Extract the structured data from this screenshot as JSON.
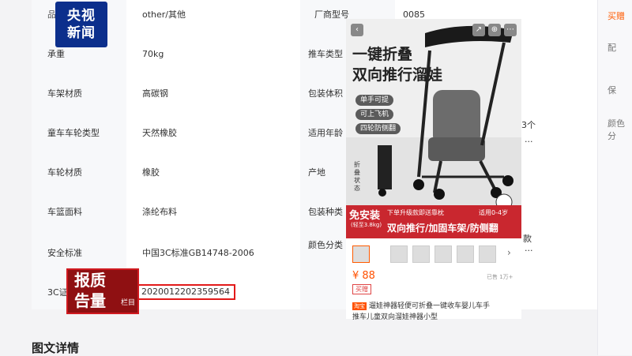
{
  "specs": {
    "left": [
      {
        "key": "品",
        "value": "other/其他"
      },
      {
        "key": "承重",
        "value": "70kg"
      },
      {
        "key": "车架材质",
        "value": "高碳钢"
      },
      {
        "key": "童车车轮类型",
        "value": "天然橡胶"
      },
      {
        "key": "车轮材质",
        "value": "橡胶"
      },
      {
        "key": "车篮面料",
        "value": "涤纶布料"
      },
      {
        "key": "安全标准",
        "value": "中国3C标准GB14748-2006"
      },
      {
        "key": "3C证",
        "value": "2020012202359564"
      }
    ],
    "right": [
      {
        "key": "厂商型号",
        "value": "0085"
      },
      {
        "key": "推车类型",
        "value": ""
      },
      {
        "key": "包装体积",
        "value": ""
      },
      {
        "key": "适用年龄",
        "value": "3个"
      },
      {
        "key": "产地",
        "value": ""
      },
      {
        "key": "包装种类",
        "value": ""
      },
      {
        "key": "颜色分类",
        "value": "款"
      }
    ]
  },
  "section_title": "图文详情",
  "right_rail": [
    "买赠",
    "配",
    "保",
    "颜色分"
  ],
  "watermark": {
    "line1": "央视",
    "line2": "新闻"
  },
  "program_logo": {
    "line1": "报质",
    "line2": "告量",
    "small": "栏目"
  },
  "product": {
    "promo_line1": "一键折叠",
    "promo_line2": "双向推行溜娃",
    "pills": [
      "单手可提",
      "可上飞机",
      "四轮防侧翻"
    ],
    "fold_label": "折叠状态",
    "banner": {
      "free_install": "免安装",
      "weight": "(轻至3.8kg)",
      "upgrade": "下单升级款即送靠枕",
      "age": "适用0-4岁",
      "features": "双向推行/加固车架/防侧翻"
    },
    "price": "¥ 88",
    "sold": "已售 1万+",
    "tag": "买赠",
    "title_badge": "淘宝",
    "title_line1": "遛娃神器轻便可折叠一键收车婴儿车手",
    "title_line2": "推车儿童双向溜娃神器小型"
  },
  "colors": {
    "accent": "#ff5000",
    "badge_blue": "#0c2f8c",
    "logo_red": "#8f1012",
    "banner_red": "#c9272f"
  }
}
